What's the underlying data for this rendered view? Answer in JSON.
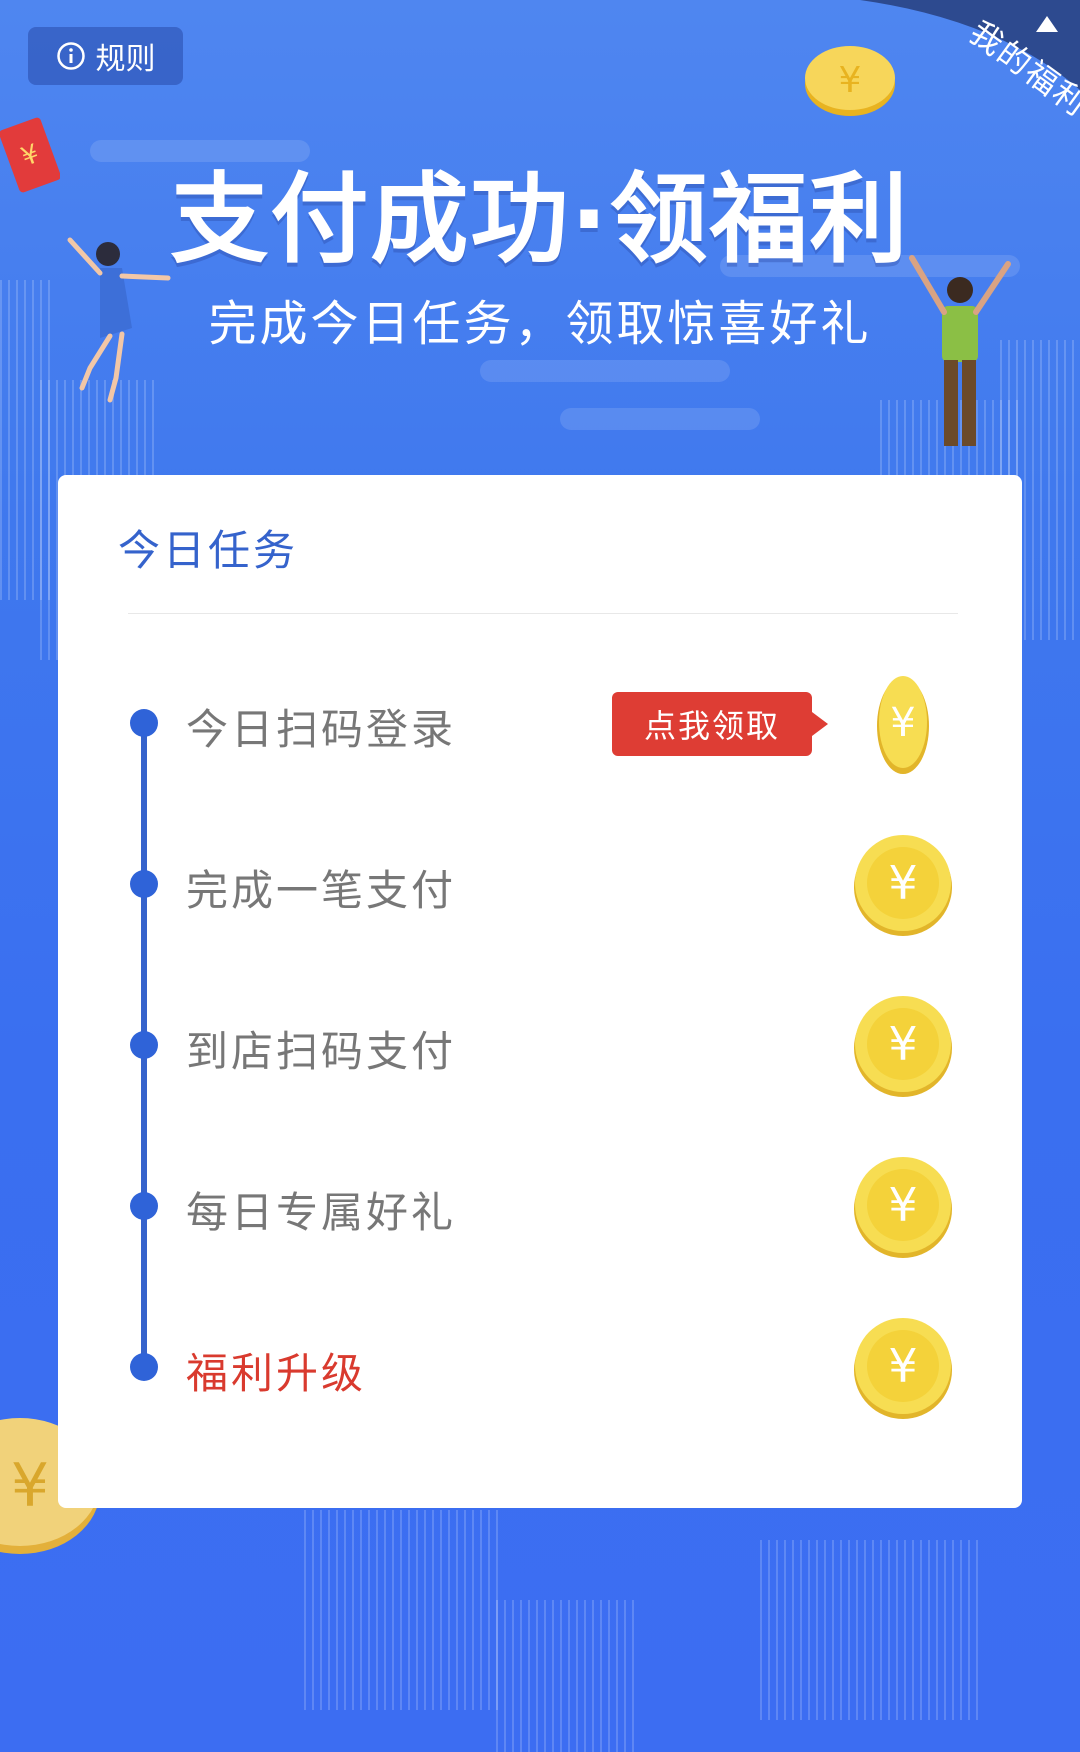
{
  "header": {
    "rules_label": "规则",
    "corner_label": "我的福利",
    "title": "支付成功·领福利",
    "subtitle": "完成今日任务，领取惊喜好礼"
  },
  "card": {
    "title": "今日任务",
    "tasks": [
      {
        "label": "今日扫码登录",
        "action": "点我领取"
      },
      {
        "label": "完成一笔支付"
      },
      {
        "label": "到店扫码支付"
      },
      {
        "label": "每日专属好礼"
      },
      {
        "label": "福利升级"
      }
    ]
  },
  "icons": {
    "rules": "info-icon",
    "coin": "yuan-coin-icon",
    "corner": "triangle-arrow-icon"
  },
  "colors": {
    "background": "#3f78ee",
    "primary": "#3563cc",
    "accent_red": "#de3d34",
    "coin_gold": "#f5d33c"
  }
}
